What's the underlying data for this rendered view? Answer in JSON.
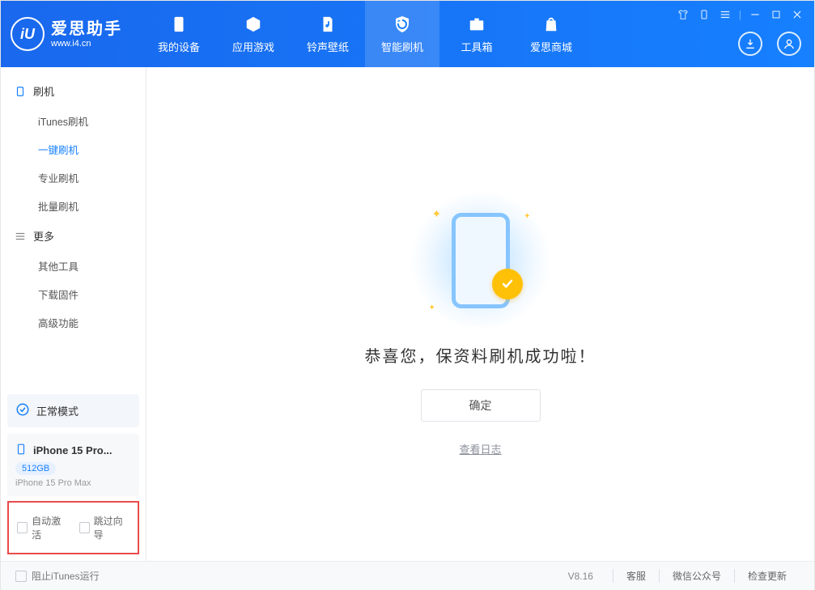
{
  "brand": {
    "title": "爱思助手",
    "subtitle": "www.i4.cn",
    "logo_letter": "iU"
  },
  "nav": [
    {
      "label": "我的设备"
    },
    {
      "label": "应用游戏"
    },
    {
      "label": "铃声壁纸"
    },
    {
      "label": "智能刷机",
      "active": true
    },
    {
      "label": "工具箱"
    },
    {
      "label": "爱思商城"
    }
  ],
  "sidebar": {
    "group1_title": "刷机",
    "items1": [
      {
        "label": "iTunes刷机"
      },
      {
        "label": "一键刷机",
        "active": true
      },
      {
        "label": "专业刷机"
      },
      {
        "label": "批量刷机"
      }
    ],
    "group2_title": "更多",
    "items2": [
      {
        "label": "其他工具"
      },
      {
        "label": "下载固件"
      },
      {
        "label": "高级功能"
      }
    ]
  },
  "status_mode": "正常模式",
  "device": {
    "name": "iPhone 15 Pro...",
    "storage": "512GB",
    "full_name": "iPhone 15 Pro Max"
  },
  "checkboxes": {
    "auto_activate": "自动激活",
    "skip_guide": "跳过向导"
  },
  "main": {
    "success_title": "恭喜您，保资料刷机成功啦！",
    "confirm_label": "确定",
    "log_link": "查看日志"
  },
  "footer": {
    "block_itunes": "阻止iTunes运行",
    "version": "V8.16",
    "links": [
      "客服",
      "微信公众号",
      "检查更新"
    ]
  }
}
